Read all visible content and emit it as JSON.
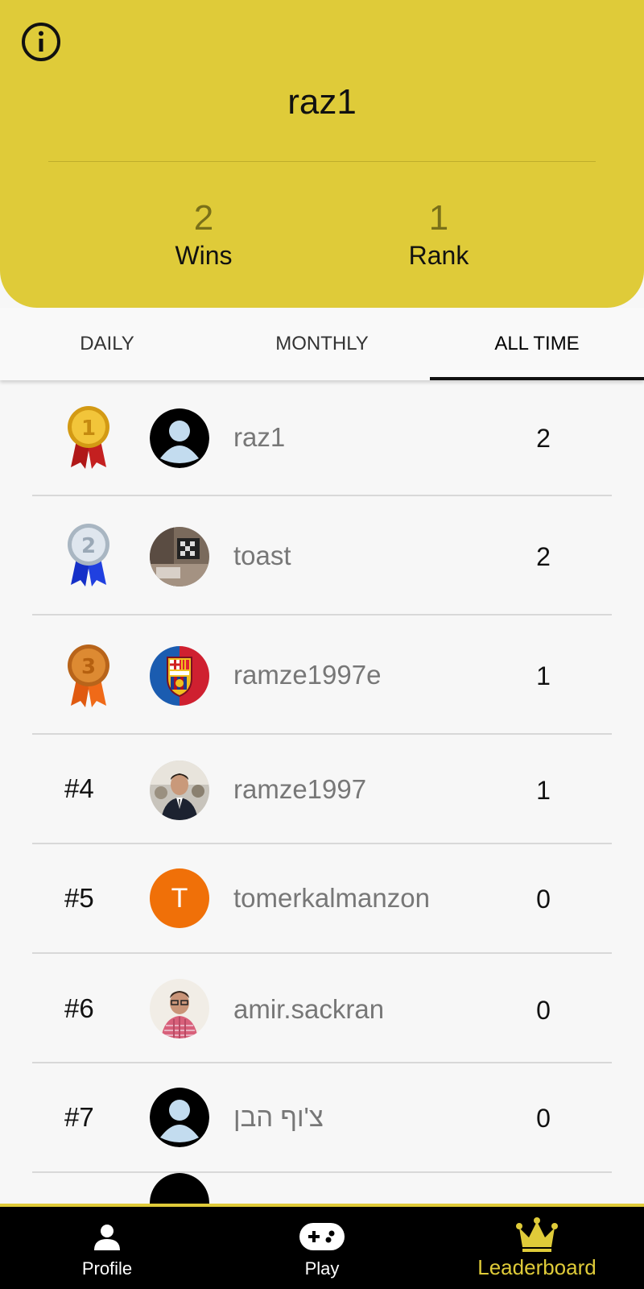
{
  "header": {
    "username": "raz1",
    "stats": [
      {
        "value": "2",
        "label": "Wins"
      },
      {
        "value": "1",
        "label": "Rank"
      }
    ]
  },
  "tabs": [
    {
      "label": "DAILY",
      "active": false
    },
    {
      "label": "MONTHLY",
      "active": false
    },
    {
      "label": "ALL TIME",
      "active": true
    }
  ],
  "leaderboard": [
    {
      "rank": "1",
      "medal": "gold",
      "avatar": "default-avatar-icon",
      "name": "raz1",
      "score": "2"
    },
    {
      "rank": "2",
      "medal": "silver",
      "avatar": "photo-room",
      "name": "toast",
      "score": "2"
    },
    {
      "rank": "3",
      "medal": "bronze",
      "avatar": "fcb-crest",
      "name": "ramze1997e",
      "score": "1"
    },
    {
      "rank": "#4",
      "avatar": "photo-man-suit",
      "name": "ramze1997",
      "score": "1"
    },
    {
      "rank": "#5",
      "avatar": "letter",
      "avatar_letter": "T",
      "avatar_color": "#f07008",
      "name": "tomerkalmanzon",
      "score": "0"
    },
    {
      "rank": "#6",
      "avatar": "photo-man-glasses",
      "name": "amir.sackran",
      "score": "0"
    },
    {
      "rank": "#7",
      "avatar": "default-avatar-icon",
      "name": "צ'וף הבן",
      "score": "0"
    }
  ],
  "nav": [
    {
      "label": "Profile",
      "icon": "person-icon",
      "active": false
    },
    {
      "label": "Play",
      "icon": "gamepad-icon",
      "active": false
    },
    {
      "label": "Leaderboard",
      "icon": "crown-icon",
      "active": true
    }
  ],
  "colors": {
    "accent": "#dfcb39",
    "gold": "#e0b020",
    "silver": "#c9d3dc",
    "bronze": "#d9731f"
  }
}
